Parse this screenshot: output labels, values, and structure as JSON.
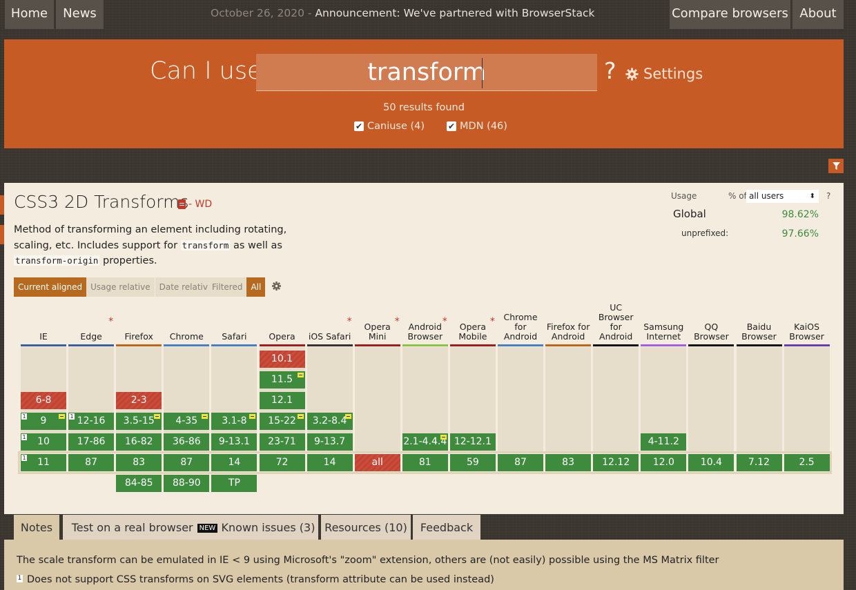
{
  "nav": {
    "home": "Home",
    "news": "News",
    "announcement_date": "October 26, 2020 -",
    "announcement_text": "Announcement: We've partnered with BrowserStack",
    "compare": "Compare browsers",
    "about": "About"
  },
  "search": {
    "prefix": "Can I use",
    "query": "transform",
    "help": "?",
    "settings": "Settings",
    "results": "50 results found",
    "filters": [
      {
        "label": "Caniuse (4)",
        "checked": true
      },
      {
        "label": "MDN (46)",
        "checked": true
      }
    ]
  },
  "feature": {
    "title": "CSS3 2D Transforms",
    "status": "- WD",
    "desc_1": "Method of transforming an element including rotating, scaling, etc. Includes support for",
    "code_1": "transform",
    "desc_2": "as well as",
    "code_2": "transform-origin",
    "desc_3": "properties."
  },
  "usage": {
    "label": "Usage",
    "pct_of": "% of",
    "users": "all users",
    "help": "?",
    "global_label": "Global",
    "global_value": "98.62%",
    "unprefixed_label": "unprefixed:",
    "unprefixed_value": "97.66%"
  },
  "view_tabs": [
    "Current aligned",
    "Usage relative",
    "Date relative"
  ],
  "filter_tabs": [
    "Filtered",
    "All"
  ],
  "browsers": [
    {
      "name": "IE",
      "line": "#3c5ea0",
      "star": false,
      "cells": [
        {
          "row": 2,
          "text": "6-8",
          "s": "n"
        },
        {
          "row": 3,
          "text": "9",
          "s": "y",
          "pfx": true,
          "note": "1"
        },
        {
          "row": 4,
          "text": "10",
          "s": "y",
          "note": "1"
        },
        {
          "row": 5,
          "text": "11",
          "s": "y",
          "note": "1"
        }
      ]
    },
    {
      "name": "Edge",
      "line": "#3c5ea0",
      "star": true,
      "cells": [
        {
          "row": 3,
          "text": "12-16",
          "s": "y",
          "note": "1"
        },
        {
          "row": 4,
          "text": "17-86",
          "s": "y"
        },
        {
          "row": 5,
          "text": "87",
          "s": "y"
        }
      ]
    },
    {
      "name": "Firefox",
      "line": "#c1651e",
      "star": false,
      "cells": [
        {
          "row": 2,
          "text": "2-3",
          "s": "n"
        },
        {
          "row": 3,
          "text": "3.5-15",
          "s": "y",
          "pfx": true
        },
        {
          "row": 4,
          "text": "16-82",
          "s": "y"
        },
        {
          "row": 5,
          "text": "83",
          "s": "y"
        },
        {
          "row": 6,
          "text": "84-85",
          "s": "y"
        }
      ]
    },
    {
      "name": "Chrome",
      "line": "#4a7ec2",
      "star": false,
      "cells": [
        {
          "row": 3,
          "text": "4-35",
          "s": "y",
          "pfx": true
        },
        {
          "row": 4,
          "text": "36-86",
          "s": "y"
        },
        {
          "row": 5,
          "text": "87",
          "s": "y"
        },
        {
          "row": 6,
          "text": "88-90",
          "s": "y"
        }
      ]
    },
    {
      "name": "Safari",
      "line": "#4a7ec2",
      "star": false,
      "cells": [
        {
          "row": 3,
          "text": "3.1-8",
          "s": "y",
          "pfx": true
        },
        {
          "row": 4,
          "text": "9-13.1",
          "s": "y"
        },
        {
          "row": 5,
          "text": "14",
          "s": "y"
        },
        {
          "row": 6,
          "text": "TP",
          "s": "y"
        }
      ]
    },
    {
      "name": "Opera",
      "line": "#a01d1d",
      "star": false,
      "cells": [
        {
          "row": 0,
          "text": "10.1",
          "s": "n"
        },
        {
          "row": 1,
          "text": "11.5",
          "s": "y",
          "pfx": true
        },
        {
          "row": 2,
          "text": "12.1",
          "s": "y"
        },
        {
          "row": 3,
          "text": "15-22",
          "s": "y",
          "pfx": true
        },
        {
          "row": 4,
          "text": "23-71",
          "s": "y"
        },
        {
          "row": 5,
          "text": "72",
          "s": "y"
        }
      ]
    },
    {
      "name": "iOS Safari",
      "line": "#333333",
      "star": true,
      "cells": [
        {
          "row": 3,
          "text": "3.2-8.4",
          "s": "y",
          "pfx": true
        },
        {
          "row": 4,
          "text": "9-13.7",
          "s": "y"
        },
        {
          "row": 5,
          "text": "14",
          "s": "y"
        }
      ]
    },
    {
      "name": "Opera Mini",
      "line": "#a01d1d",
      "star": true,
      "cells": [
        {
          "row": 5,
          "text": "all",
          "s": "n"
        }
      ]
    },
    {
      "name": "Android Browser",
      "line": "#8bc34a",
      "star": true,
      "cells": [
        {
          "row": 4,
          "text": "2.1-4.4.4",
          "s": "y",
          "pfx": true
        },
        {
          "row": 5,
          "text": "81",
          "s": "y"
        }
      ]
    },
    {
      "name": "Opera Mobile",
      "line": "#a01d1d",
      "star": true,
      "cells": [
        {
          "row": 4,
          "text": "12-12.1",
          "s": "y"
        },
        {
          "row": 5,
          "text": "59",
          "s": "y"
        }
      ]
    },
    {
      "name": "Chrome for Android",
      "line": "#4a7ec2",
      "star": false,
      "cells": [
        {
          "row": 5,
          "text": "87",
          "s": "y"
        }
      ]
    },
    {
      "name": "Firefox for Android",
      "line": "#c1651e",
      "star": false,
      "cells": [
        {
          "row": 5,
          "text": "83",
          "s": "y"
        }
      ]
    },
    {
      "name": "UC Browser for Android",
      "line": "#111111",
      "star": false,
      "cells": [
        {
          "row": 5,
          "text": "12.12",
          "s": "y"
        }
      ]
    },
    {
      "name": "Samsung Internet",
      "line": "#a35de0",
      "star": false,
      "cells": [
        {
          "row": 4,
          "text": "4-11.2",
          "s": "y"
        },
        {
          "row": 5,
          "text": "12.0",
          "s": "y"
        }
      ]
    },
    {
      "name": "QQ Browser",
      "line": "#111111",
      "star": false,
      "cells": [
        {
          "row": 5,
          "text": "10.4",
          "s": "y"
        }
      ]
    },
    {
      "name": "Baidu Browser",
      "line": "#111111",
      "star": false,
      "cells": [
        {
          "row": 5,
          "text": "7.12",
          "s": "y"
        }
      ]
    },
    {
      "name": "KaiOS Browser",
      "line": "#6a3ab4",
      "star": false,
      "cells": [
        {
          "row": 5,
          "text": "2.5",
          "s": "y"
        }
      ]
    }
  ],
  "bottom_tabs": {
    "notes": "Notes",
    "test": "Test on a real browser",
    "new_badge": "NEW",
    "known": "Known issues (3)",
    "resources": "Resources (10)",
    "feedback": "Feedback"
  },
  "notes": {
    "main": "The scale transform can be emulated in IE < 9 using Microsoft's \"zoom\" extension, others are (not easily) possible using the MS Matrix filter",
    "note1_num": "1",
    "note1": "Does not support CSS transforms on SVG elements (transform attribute can be used instead)"
  },
  "colors": {
    "accent": "#c75b25",
    "supported": "#3e8b3e",
    "unsupported": "#c44230",
    "prefix_flag": "#eee63c"
  }
}
